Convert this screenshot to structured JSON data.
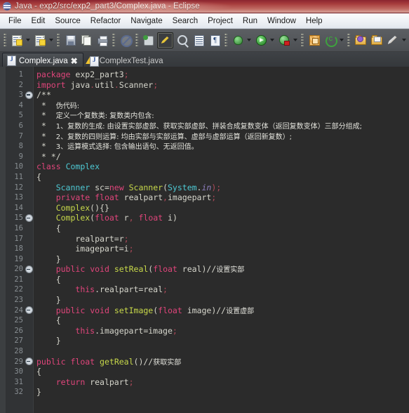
{
  "window": {
    "title": "Java - exp2/src/exp2_part3/Complex.java - Eclipse",
    "logo_icon": "eclipse-logo-icon"
  },
  "menubar": {
    "items": [
      "File",
      "Edit",
      "Source",
      "Refactor",
      "Navigate",
      "Search",
      "Project",
      "Run",
      "Window",
      "Help"
    ]
  },
  "toolbar": {
    "groups": [
      {
        "icons": [
          "new-java-project-icon",
          "dropdown-arrow",
          "new-java-class-icon",
          "dropdown-arrow"
        ]
      },
      {
        "icons": [
          "save-icon",
          "save-all-icon",
          "print-icon"
        ]
      },
      {
        "icons": [
          "skip-all-breakpoints-icon"
        ]
      },
      {
        "icons": [
          "build-all-icon",
          "toggle-mark-occurrences-icon",
          "search-icon",
          "open-task-icon",
          "show-whitespace-icon"
        ]
      },
      {
        "icons": [
          "debug-icon",
          "dropdown-arrow",
          "run-icon",
          "dropdown-arrow",
          "run-coverage-icon",
          "dropdown-arrow"
        ]
      },
      {
        "icons": [
          "new-java-project2-icon",
          "refresh-icon",
          "dropdown-arrow"
        ]
      },
      {
        "icons": [
          "open-type-icon",
          "open-task-folder-icon",
          "annotate-pencil-icon",
          "dropdown-arrow"
        ]
      }
    ]
  },
  "tabs": [
    {
      "label": "Complex.java",
      "icon": "java-file-icon",
      "active": true,
      "closable": true
    },
    {
      "label": "ComplexTest.java",
      "icon": "java-file-warning-icon",
      "active": false,
      "closable": false
    }
  ],
  "editor": {
    "first_line": 1,
    "last_line": 32,
    "fold_markers": [
      3,
      15,
      20,
      24,
      29
    ],
    "lines": [
      {
        "n": 1,
        "segments": [
          {
            "t": "package",
            "c": "kw2"
          },
          {
            "t": " exp2_part3",
            "c": "plain"
          },
          {
            "t": ";",
            "c": "semi"
          }
        ]
      },
      {
        "n": 2,
        "segments": [
          {
            "t": "import",
            "c": "kw2"
          },
          {
            "t": " java",
            "c": "plain"
          },
          {
            "t": ".",
            "c": "semi"
          },
          {
            "t": "util",
            "c": "plain"
          },
          {
            "t": ".",
            "c": "semi"
          },
          {
            "t": "Scanner",
            "c": "plain"
          },
          {
            "t": ";",
            "c": "semi"
          }
        ]
      },
      {
        "n": 3,
        "segments": [
          {
            "t": "/**",
            "c": "cmtz"
          }
        ]
      },
      {
        "n": 4,
        "segments": [
          {
            "t": " *  ",
            "c": "cmtz"
          },
          {
            "t": "伪代码:",
            "c": "cmt-zh"
          }
        ]
      },
      {
        "n": 5,
        "segments": [
          {
            "t": " *  ",
            "c": "cmtz"
          },
          {
            "t": "定义一个复数类: 复数类内包含:",
            "c": "cmt-zh"
          }
        ]
      },
      {
        "n": 6,
        "segments": [
          {
            "t": " *  ",
            "c": "cmtz"
          },
          {
            "t": "1、复数的生成: 由设置实部虚部、获取实部虚部、拼装合成复数变体（返回复数变体）三部分组成;",
            "c": "cmt-zh"
          }
        ]
      },
      {
        "n": 7,
        "segments": [
          {
            "t": " *  ",
            "c": "cmtz"
          },
          {
            "t": "2、复数的四则运算: 均由实部与实部运算、虚部与虚部运算（返回新复数）;",
            "c": "cmt-zh"
          }
        ]
      },
      {
        "n": 8,
        "segments": [
          {
            "t": " *  ",
            "c": "cmtz"
          },
          {
            "t": "3、运算模式选择: 包含输出语句、无返回值。",
            "c": "cmt-zh"
          }
        ]
      },
      {
        "n": 9,
        "segments": [
          {
            "t": " * */",
            "c": "cmtz"
          }
        ]
      },
      {
        "n": 10,
        "segments": [
          {
            "t": "class",
            "c": "kw2"
          },
          {
            "t": " ",
            "c": "plain"
          },
          {
            "t": "Complex",
            "c": "type"
          }
        ]
      },
      {
        "n": 11,
        "segments": [
          {
            "t": "{",
            "c": "plain"
          }
        ]
      },
      {
        "n": 12,
        "segments": [
          {
            "t": "    ",
            "c": "plain"
          },
          {
            "t": "Scanner",
            "c": "type"
          },
          {
            "t": " sc=",
            "c": "plain"
          },
          {
            "t": "new",
            "c": "kw2"
          },
          {
            "t": " ",
            "c": "plain"
          },
          {
            "t": "Scanner",
            "c": "mth"
          },
          {
            "t": "(",
            "c": "plain"
          },
          {
            "t": "System",
            "c": "type"
          },
          {
            "t": ".",
            "c": "plain"
          },
          {
            "t": "in",
            "c": "ital"
          },
          {
            "t": ");",
            "c": "semi"
          }
        ]
      },
      {
        "n": 13,
        "segments": [
          {
            "t": "    ",
            "c": "plain"
          },
          {
            "t": "private",
            "c": "kw2"
          },
          {
            "t": " ",
            "c": "plain"
          },
          {
            "t": "float",
            "c": "kw2"
          },
          {
            "t": " realpart",
            "c": "plain"
          },
          {
            "t": ",",
            "c": "semi"
          },
          {
            "t": "imagepart",
            "c": "plain"
          },
          {
            "t": ";",
            "c": "semi"
          }
        ]
      },
      {
        "n": 14,
        "segments": [
          {
            "t": "    ",
            "c": "plain"
          },
          {
            "t": "Complex",
            "c": "mth"
          },
          {
            "t": "(){}",
            "c": "plain"
          }
        ]
      },
      {
        "n": 15,
        "segments": [
          {
            "t": "    ",
            "c": "plain"
          },
          {
            "t": "Complex",
            "c": "mth"
          },
          {
            "t": "(",
            "c": "plain"
          },
          {
            "t": "float",
            "c": "kw2"
          },
          {
            "t": " r",
            "c": "plain"
          },
          {
            "t": ",",
            "c": "semi"
          },
          {
            "t": " ",
            "c": "plain"
          },
          {
            "t": "float",
            "c": "kw2"
          },
          {
            "t": " i)",
            "c": "plain"
          }
        ]
      },
      {
        "n": 16,
        "segments": [
          {
            "t": "    {",
            "c": "plain"
          }
        ]
      },
      {
        "n": 17,
        "segments": [
          {
            "t": "        realpart=r",
            "c": "plain"
          },
          {
            "t": ";",
            "c": "semi"
          }
        ]
      },
      {
        "n": 18,
        "segments": [
          {
            "t": "        imagepart=i",
            "c": "plain"
          },
          {
            "t": ";",
            "c": "semi"
          }
        ]
      },
      {
        "n": 19,
        "segments": [
          {
            "t": "    }",
            "c": "plain"
          }
        ]
      },
      {
        "n": 20,
        "segments": [
          {
            "t": "    ",
            "c": "plain"
          },
          {
            "t": "public",
            "c": "kw2"
          },
          {
            "t": " ",
            "c": "plain"
          },
          {
            "t": "void",
            "c": "kw2"
          },
          {
            "t": " ",
            "c": "plain"
          },
          {
            "t": "setReal",
            "c": "mth"
          },
          {
            "t": "(",
            "c": "plain"
          },
          {
            "t": "float",
            "c": "kw2"
          },
          {
            "t": " real)",
            "c": "plain"
          },
          {
            "t": "//",
            "c": "cmtz"
          },
          {
            "t": "设置实部",
            "c": "cmt-zh"
          }
        ]
      },
      {
        "n": 21,
        "segments": [
          {
            "t": "    {",
            "c": "plain"
          }
        ]
      },
      {
        "n": 22,
        "segments": [
          {
            "t": "        ",
            "c": "plain"
          },
          {
            "t": "this",
            "c": "kw2"
          },
          {
            "t": ".realpart=real",
            "c": "plain"
          },
          {
            "t": ";",
            "c": "semi"
          }
        ]
      },
      {
        "n": 23,
        "segments": [
          {
            "t": "    }",
            "c": "plain"
          }
        ]
      },
      {
        "n": 24,
        "segments": [
          {
            "t": "    ",
            "c": "plain"
          },
          {
            "t": "public",
            "c": "kw2"
          },
          {
            "t": " ",
            "c": "plain"
          },
          {
            "t": "void",
            "c": "kw2"
          },
          {
            "t": " ",
            "c": "plain"
          },
          {
            "t": "setImage",
            "c": "mth"
          },
          {
            "t": "(",
            "c": "plain"
          },
          {
            "t": "float",
            "c": "kw2"
          },
          {
            "t": " image)",
            "c": "plain"
          },
          {
            "t": "//",
            "c": "cmtz"
          },
          {
            "t": "设置虚部",
            "c": "cmt-zh"
          }
        ]
      },
      {
        "n": 25,
        "segments": [
          {
            "t": "    {",
            "c": "plain"
          }
        ]
      },
      {
        "n": 26,
        "segments": [
          {
            "t": "        ",
            "c": "plain"
          },
          {
            "t": "this",
            "c": "kw2"
          },
          {
            "t": ".imagepart=image",
            "c": "plain"
          },
          {
            "t": ";",
            "c": "semi"
          }
        ]
      },
      {
        "n": 27,
        "segments": [
          {
            "t": "    }",
            "c": "plain"
          }
        ]
      },
      {
        "n": 28,
        "segments": [
          {
            "t": "",
            "c": "plain"
          }
        ]
      },
      {
        "n": 29,
        "segments": [
          {
            "t": "public",
            "c": "kw2"
          },
          {
            "t": " ",
            "c": "plain"
          },
          {
            "t": "float",
            "c": "kw2"
          },
          {
            "t": " ",
            "c": "plain"
          },
          {
            "t": "getReal",
            "c": "mth"
          },
          {
            "t": "()",
            "c": "plain"
          },
          {
            "t": "//",
            "c": "cmtz"
          },
          {
            "t": "获取实部",
            "c": "cmt-zh"
          }
        ]
      },
      {
        "n": 30,
        "segments": [
          {
            "t": "{",
            "c": "plain"
          }
        ]
      },
      {
        "n": 31,
        "segments": [
          {
            "t": "    ",
            "c": "plain"
          },
          {
            "t": "return",
            "c": "kw2"
          },
          {
            "t": " realpart",
            "c": "plain"
          },
          {
            "t": ";",
            "c": "semi"
          }
        ]
      },
      {
        "n": 32,
        "segments": [
          {
            "t": "}",
            "c": "plain"
          }
        ]
      }
    ]
  },
  "colors": {
    "titlebar": "#a63c3c",
    "toolbar": "#54575b",
    "editor_bg": "#2b2b2b",
    "gutter_bg": "#313335",
    "keyword": "#e0457b",
    "type": "#4ec9d4",
    "method": "#c8d94a",
    "comment": "#d6d6cc"
  }
}
